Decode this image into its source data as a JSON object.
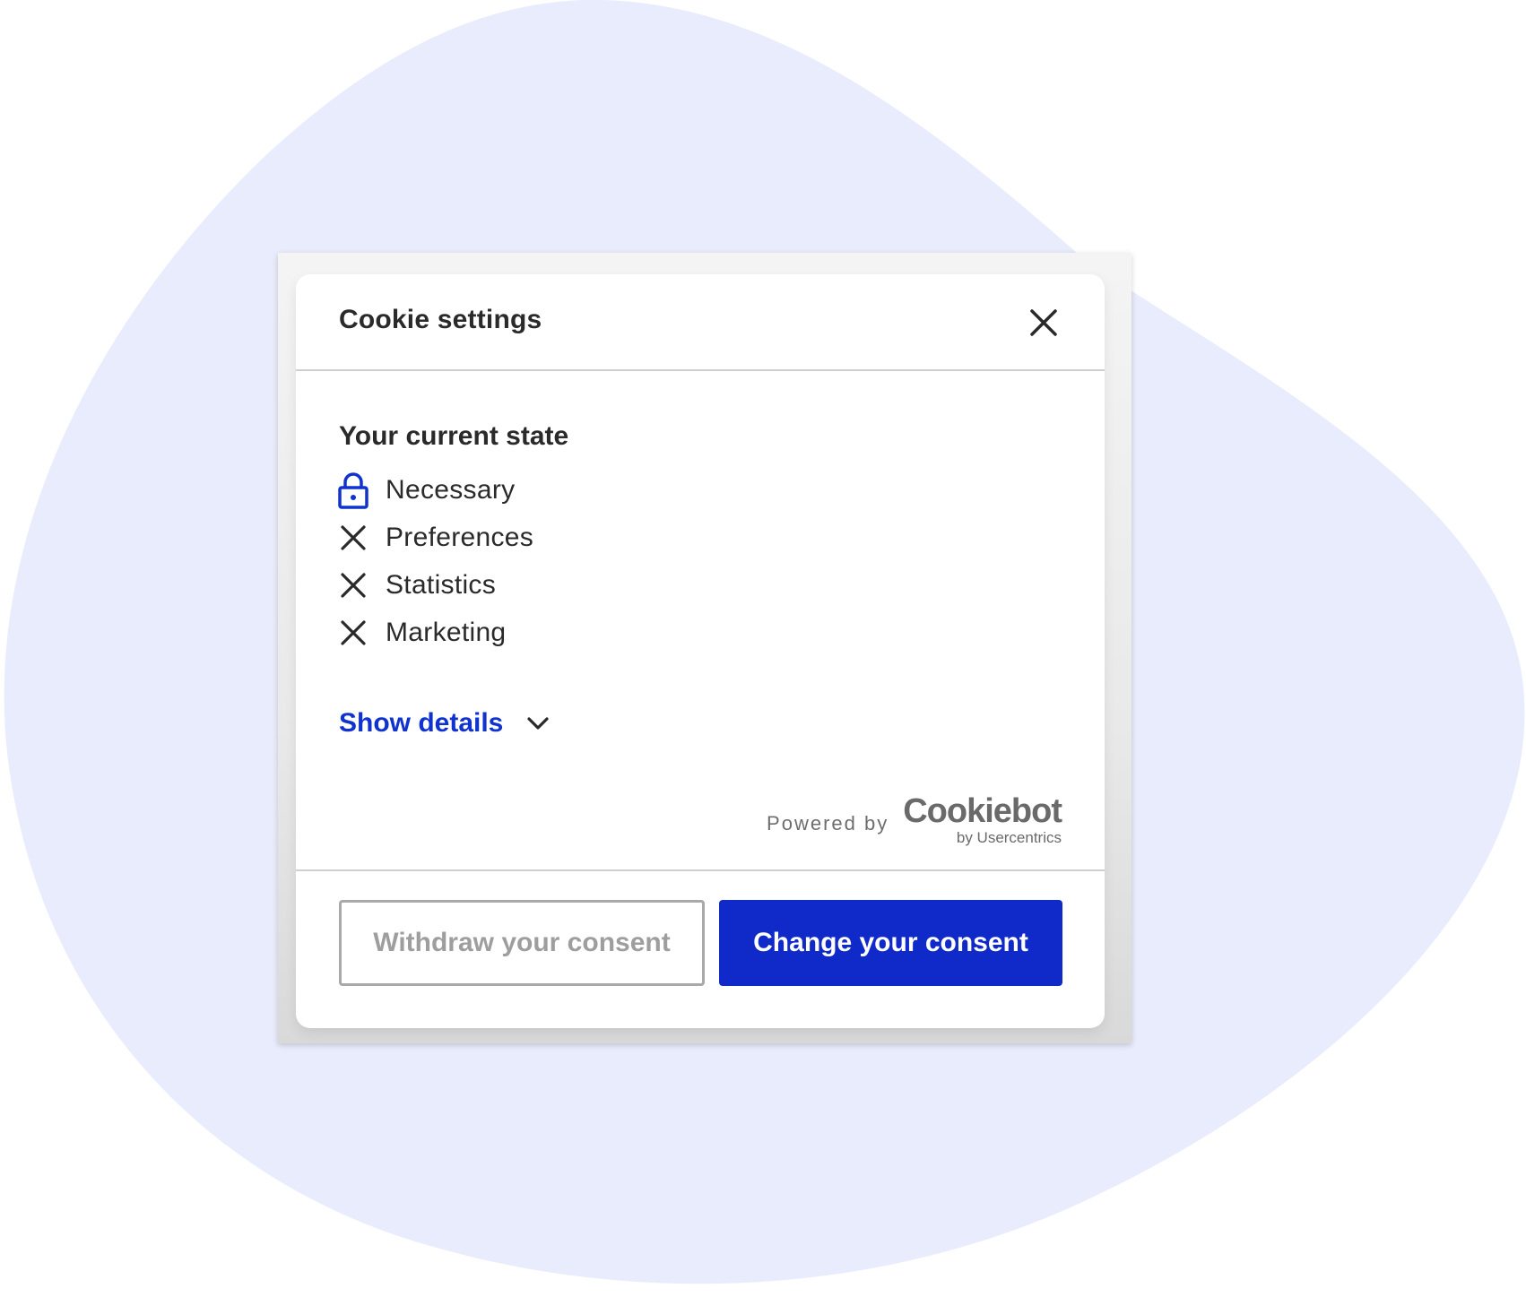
{
  "colors": {
    "accent": "#1032cf",
    "primary_button": "#1029c9",
    "background_blob": "#e9ecfc",
    "text": "#2a2a2a"
  },
  "dialog": {
    "title": "Cookie settings",
    "close_icon": "close-icon"
  },
  "current_state": {
    "heading": "Your current state",
    "items": [
      {
        "label": "Necessary",
        "icon": "lock-icon",
        "status": "required"
      },
      {
        "label": "Preferences",
        "icon": "x-icon",
        "status": "declined"
      },
      {
        "label": "Statistics",
        "icon": "x-icon",
        "status": "declined"
      },
      {
        "label": "Marketing",
        "icon": "x-icon",
        "status": "declined"
      }
    ]
  },
  "details": {
    "toggle_label": "Show details",
    "icon": "chevron-down-icon"
  },
  "branding": {
    "powered_by": "Powered by",
    "logo_name": "Cookiebot",
    "logo_sub": "by Usercentrics"
  },
  "actions": {
    "withdraw_label": "Withdraw your consent",
    "change_label": "Change your consent"
  }
}
